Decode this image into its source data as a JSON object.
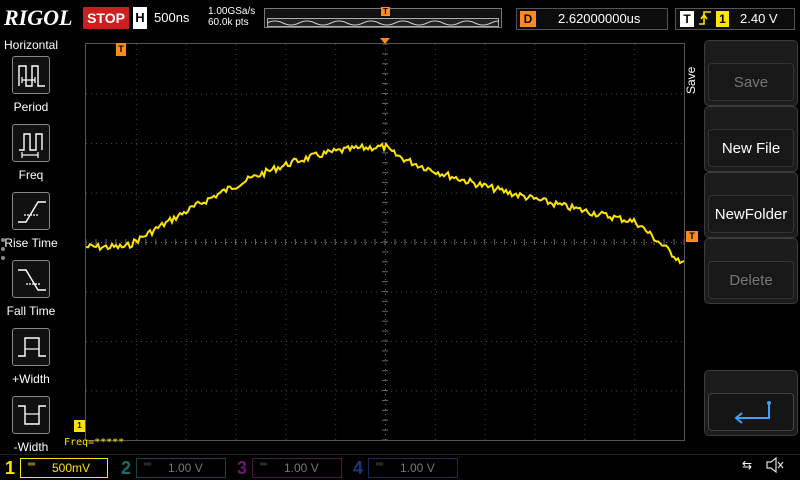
{
  "brand": "RIGOL",
  "run_state": "STOP",
  "horizontal": {
    "label": "H",
    "timebase": "500ns",
    "sample_rate": "1.00GSa/s",
    "mem_depth": "60.0k pts"
  },
  "trigger_delay": {
    "label": "D",
    "value": "2.62000000us"
  },
  "trigger": {
    "label": "T",
    "edge": "rising",
    "source": "1",
    "level": "2.40 V"
  },
  "left_menu": {
    "title": "Horizontal",
    "items": [
      {
        "label": "Period",
        "icon": "period-icon"
      },
      {
        "label": "Freq",
        "icon": "frequency-icon"
      },
      {
        "label": "Rise Time",
        "icon": "rise-time-icon"
      },
      {
        "label": "Fall Time",
        "icon": "fall-time-icon"
      },
      {
        "label": "+Width",
        "icon": "positive-width-icon"
      },
      {
        "label": "-Width",
        "icon": "negative-width-icon"
      }
    ]
  },
  "right_menu": {
    "title": "Save",
    "buttons": [
      {
        "label": "Save",
        "enabled": false
      },
      {
        "label": "New File",
        "enabled": true
      },
      {
        "label": "NewFolder",
        "enabled": true
      },
      {
        "label": "Delete",
        "enabled": false
      },
      {
        "label": "",
        "icon": "enter-icon",
        "enabled": true
      }
    ]
  },
  "measurement": {
    "text": "Freq=*****"
  },
  "markers": {
    "t_marker": "T",
    "ch1_marker": "1",
    "trigger_level_marker": "T"
  },
  "channels": [
    {
      "num": "1",
      "scale": "500mV",
      "color": "#ffe400",
      "active": true
    },
    {
      "num": "2",
      "scale": "1.00 V",
      "color": "#00c8c8",
      "active": false
    },
    {
      "num": "3",
      "scale": "1.00 V",
      "color": "#e000e0",
      "active": false
    },
    {
      "num": "4",
      "scale": "1.00 V",
      "color": "#2a7bff",
      "active": false
    }
  ],
  "status_icons": {
    "usb": "usb-icon",
    "speaker": "speaker-muted-icon"
  },
  "colors": {
    "ch1": "#ffe400",
    "trigger": "#ff8c1a",
    "stop": "#cc1f1f"
  }
}
